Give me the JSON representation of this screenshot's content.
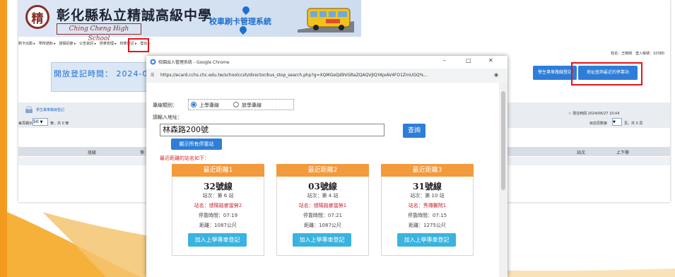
{
  "site": {
    "logo_char": "精",
    "school_name": "彰化縣私立精誠高級中學",
    "school_en": "Ching Cheng High School",
    "system_name": "校車刷卡管理系統",
    "nav_items": [
      "刷卡出勤 ▸",
      "學校通知 ▸",
      "請假紀錄 ▸",
      "公告資訊 ▸",
      "校車管理 ▸",
      "校車登記 ▸",
      "登出 ▸"
    ],
    "user_label": "姓名：王曉晴　登入帳號：10380",
    "open_period": "開放登記時間： 2024-06",
    "btn_student_route": "學生專車路線登記",
    "btn_address_query": "地址查詢最近的停靠站",
    "record_title": "學生專車路線登記",
    "now_time": "☆ 現在時間 2024/06/27 10:04",
    "per_page_label": "每頁顯示：",
    "per_page_value": "50",
    "per_page_suffix": "筆，共 0 筆",
    "page_label": "目前頁數第",
    "page_suffix": "頁，共 0 頁",
    "col_class": "班級",
    "col_student": "學",
    "col_stop": "站次",
    "col_direction": "上下學",
    "accent_color": "#2e7ed8",
    "highlight_color": "#e4141b"
  },
  "popup": {
    "window_title": "校園出入管理系統 - Google Chrome",
    "url": "https://ecard.cchs.chc.edu.tw/schoolccsh/director/bus_stop_search.php?g=XQMGeQd9VGRaZQAQVJIQYAJxAV4FO1ZmUGQ%...",
    "route_type_label": "專線類別：",
    "radio_up": "上學專線",
    "radio_down": "放學專線",
    "address_prompt": "請輸入地址：",
    "address_value": "林森路200號",
    "query_button": "查詢",
    "show_all_button": "顯示所有停靠站",
    "nearest_note": "最近距離的站名如下：",
    "cards": [
      {
        "header": "最近距離1",
        "route": "32號線",
        "stop_no": "站次：第 6 站",
        "stop_name": "站名：總陽路麥當勞2",
        "time": "停靠時間：07:19",
        "distance": "距離：1087公尺",
        "button": "加入上學專車登記"
      },
      {
        "header": "最近距離2",
        "route": "03號線",
        "stop_no": "站次：第 4 站",
        "stop_name": "站名：總陽路麥當勞1",
        "time": "停靠時間：07:21",
        "distance": "距離：1087公尺",
        "button": "加入上學專車登記"
      },
      {
        "header": "最近距離3",
        "route": "31號線",
        "stop_no": "站次：第 10 站",
        "stop_name": "站名：秀傳醫院1",
        "time": "停靠時間：07:15",
        "distance": "距離：1275公尺",
        "button": "加入上學專車登記"
      }
    ],
    "card_header_color": "#f39a3d",
    "card_button_color": "#39b3e0"
  }
}
